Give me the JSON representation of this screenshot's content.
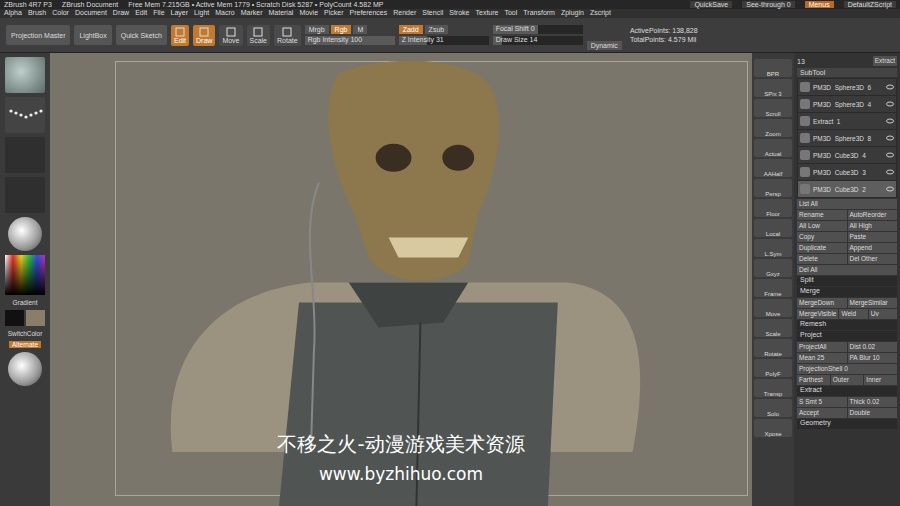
{
  "window": {
    "title": "ZBrush 4R7 P3",
    "document": "ZBrush Document",
    "info": "Free Mem 7.215GB • Active Mem 1779 • Scratch Disk 5287 • PolyCount 4.582 MP"
  },
  "menus": [
    "Alpha",
    "Brush",
    "Color",
    "Document",
    "Draw",
    "Edit",
    "File",
    "Layer",
    "Light",
    "Macro",
    "Marker",
    "Material",
    "Movie",
    "Picker",
    "Preferences",
    "Render",
    "Stencil",
    "Stroke",
    "Texture",
    "Tool",
    "Transform",
    "Zplugin",
    "Zscript"
  ],
  "top_right": [
    {
      "label": "QuickSave",
      "selected": false
    },
    {
      "label": "See-through 0",
      "selected": false
    },
    {
      "label": "Menus",
      "selected": true
    },
    {
      "label": "DefaultZScript",
      "selected": false
    }
  ],
  "toolbar": {
    "big_buttons": [
      "Projection Master",
      "LightBox",
      "Quick Sketch"
    ],
    "modes": [
      {
        "label": "Edit",
        "selected": true
      },
      {
        "label": "Draw",
        "selected": true
      },
      {
        "label": "Move",
        "selected": false
      },
      {
        "label": "Scale",
        "selected": false
      },
      {
        "label": "Rotate",
        "selected": false
      }
    ],
    "color_modes": [
      {
        "label": "Mrgb",
        "selected": false
      },
      {
        "label": "Rgb",
        "selected": true
      },
      {
        "label": "M",
        "selected": false
      }
    ],
    "z_modes": [
      {
        "label": "Zadd",
        "selected": true
      },
      {
        "label": "Zsub",
        "selected": false
      }
    ],
    "sliders": [
      {
        "label": "Rgb Intensity 100",
        "level": 1
      },
      {
        "label": "Z Intensity 31",
        "level": 0.31
      },
      {
        "label": "Focal Shift 0",
        "level": 0.5
      },
      {
        "label": "Draw Size 14",
        "level": 0.1
      }
    ],
    "dynamic": "Dynamic",
    "active_points": "ActivePoints: 138,828",
    "total_points": "TotalPoints: 4.579 Mil"
  },
  "left": {
    "gradient": "Gradient",
    "switch_color": "SwitchColor",
    "alternate": "Alternate"
  },
  "shelf": [
    "BPR",
    "SPix 3",
    "Scroll",
    "Zoom",
    "Actual",
    "AAHalf",
    "Persp",
    "Floor",
    "Local",
    "L.Sym",
    "Gxyz",
    "Frame",
    "Move",
    "Scale",
    "Rotate",
    "PolyF",
    "Transp",
    "Solo",
    "Xpose"
  ],
  "subtool": {
    "count": "13",
    "extract": "Extract",
    "title": "SubTool",
    "items": [
      {
        "name": "PM3D_Sphere3D_6",
        "selected": false
      },
      {
        "name": "PM3D_Sphere3D_4",
        "selected": false
      },
      {
        "name": "Extract_1",
        "selected": false
      },
      {
        "name": "PM3D_Sphere3D_8",
        "selected": false
      },
      {
        "name": "PM3D_Cube3D_4",
        "selected": false
      },
      {
        "name": "PM3D_Cube3D_3",
        "selected": false
      },
      {
        "name": "PM3D_Cube3D_2",
        "selected": true
      }
    ],
    "rows": [
      {
        "kind": "buttons",
        "items": [
          "List All"
        ]
      },
      {
        "kind": "buttons",
        "items": [
          "Rename",
          "AutoReorder"
        ]
      },
      {
        "kind": "buttons",
        "items": [
          "All Low",
          "All High"
        ]
      },
      {
        "kind": "buttons",
        "items": [
          "Copy",
          "Paste"
        ]
      },
      {
        "kind": "buttons",
        "items": [
          "Duplicate",
          "Append"
        ]
      },
      {
        "kind": "buttons",
        "items": [
          "Delete",
          "Del Other"
        ]
      },
      {
        "kind": "buttons",
        "items": [
          "Del All"
        ]
      },
      {
        "kind": "header",
        "items": [
          "Split"
        ]
      },
      {
        "kind": "header",
        "items": [
          "Merge"
        ]
      },
      {
        "kind": "buttons",
        "items": [
          "MergeDown",
          "MergeSimilar"
        ]
      },
      {
        "kind": "buttons",
        "items": [
          "MergeVisible",
          "Weld",
          "Uv"
        ]
      },
      {
        "kind": "header",
        "items": [
          "Remesh"
        ]
      },
      {
        "kind": "header",
        "items": [
          "Project"
        ]
      },
      {
        "kind": "buttons",
        "items": [
          "ProjectAll",
          "Dist 0.02"
        ]
      },
      {
        "kind": "buttons",
        "items": [
          "Mean 25",
          "PA Blur 10"
        ]
      },
      {
        "kind": "buttons",
        "items": [
          "ProjectionShell 0"
        ]
      },
      {
        "kind": "buttons",
        "items": [
          "Farthest",
          "Outer",
          "Inner"
        ]
      },
      {
        "kind": "header",
        "items": [
          "Extract"
        ]
      },
      {
        "kind": "buttons",
        "items": [
          "S Smt 5",
          "Thick 0.02"
        ]
      },
      {
        "kind": "buttons",
        "items": [
          "Accept",
          "Double"
        ]
      },
      {
        "kind": "header",
        "items": [
          "Geometry"
        ]
      }
    ]
  },
  "watermark": {
    "title": "不移之火-动漫游戏美术资源",
    "url": "www.byzhihuo.com"
  }
}
